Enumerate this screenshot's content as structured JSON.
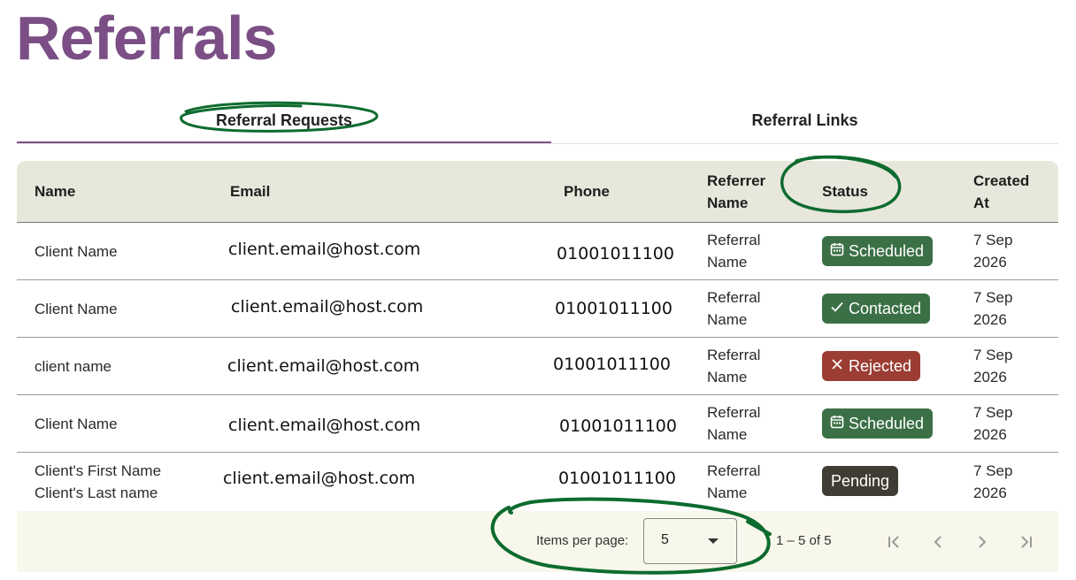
{
  "page": {
    "title": "Referrals"
  },
  "tabs": [
    {
      "label": "Referral Requests",
      "active": true
    },
    {
      "label": "Referral Links",
      "active": false
    }
  ],
  "table": {
    "headers": {
      "name": "Name",
      "email": "Email",
      "phone": "Phone",
      "referrer_line1": "Referrer",
      "referrer_line2": "Name",
      "status": "Status",
      "created_line1": "Created",
      "created_line2": "At"
    },
    "rows": [
      {
        "name_line1": "Client Name",
        "name_line2": "",
        "email": "client.email@host.com",
        "phone": "01001011100",
        "referrer_line1": "Referral",
        "referrer_line2": "Name",
        "status": "Scheduled",
        "status_icon": "calendar-icon",
        "created_line1": "7 Sep",
        "created_line2": "2026"
      },
      {
        "name_line1": "Client Name",
        "name_line2": "",
        "email": "client.email@host.com",
        "phone": "01001011100",
        "referrer_line1": "Referral",
        "referrer_line2": "Name",
        "status": "Contacted",
        "status_icon": "check-icon",
        "created_line1": "7 Sep",
        "created_line2": "2026"
      },
      {
        "name_line1": "client name",
        "name_line2": "",
        "email": "client.email@host.com",
        "phone": "01001011100",
        "referrer_line1": "Referral",
        "referrer_line2": "Name",
        "status": "Rejected",
        "status_icon": "close-icon",
        "created_line1": "7 Sep",
        "created_line2": "2026"
      },
      {
        "name_line1": "Client Name",
        "name_line2": "",
        "email": "client.email@host.com",
        "phone": "01001011100",
        "referrer_line1": "Referral",
        "referrer_line2": "Name",
        "status": "Scheduled",
        "status_icon": "calendar-icon",
        "created_line1": "7 Sep",
        "created_line2": "2026"
      },
      {
        "name_line1": "Client's First Name",
        "name_line2": "Client's Last name",
        "email": "client.email@host.com",
        "phone": "01001011100",
        "referrer_line1": "Referral",
        "referrer_line2": "Name",
        "status": "Pending",
        "status_icon": "",
        "created_line1": "7 Sep",
        "created_line2": "2026"
      }
    ]
  },
  "paginator": {
    "items_per_page_label": "Items per page:",
    "items_per_page_value": "5",
    "range": "1 – 5 of 5",
    "icons": [
      "first-page-icon",
      "previous-page-icon",
      "next-page-icon",
      "last-page-icon"
    ]
  },
  "colors": {
    "title": "#7b4f86",
    "tab_indicator": "#7b4f86",
    "header_bg": "#e8e7dc",
    "footer_bg": "#f8f7eb",
    "status_scheduled": "#3b7046",
    "status_contacted": "#3b7046",
    "status_rejected": "#9b3d33",
    "status_pending": "#3f3d33",
    "annotation": "#0d6b2e"
  }
}
